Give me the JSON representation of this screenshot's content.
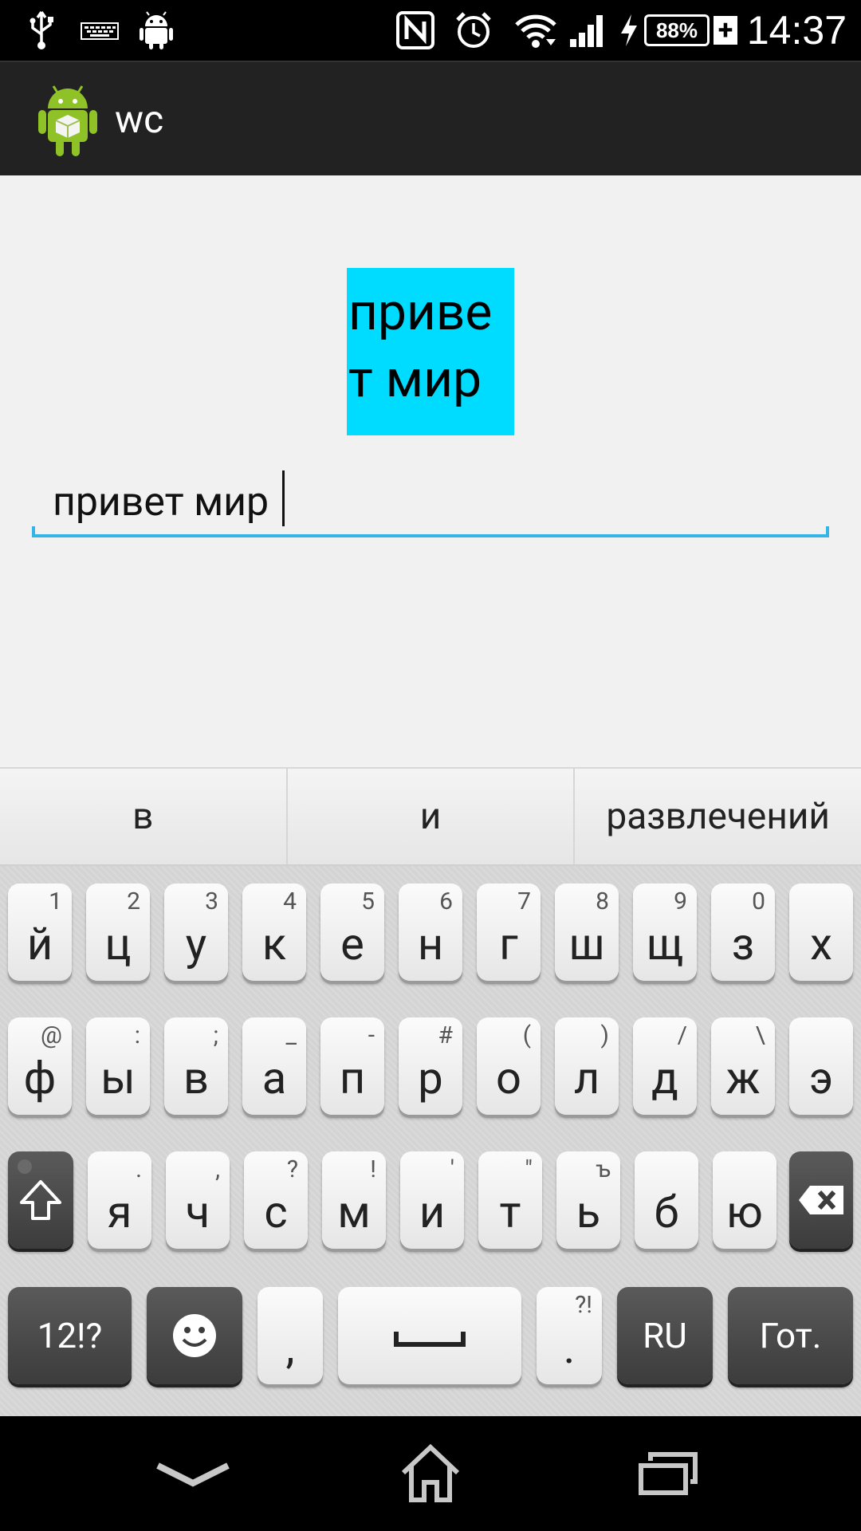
{
  "status_bar": {
    "time": "14:37",
    "battery_percent": "88%",
    "icons": [
      "usb-icon",
      "keyboard-icon",
      "android-debug-icon",
      "nfc-icon",
      "alarm-icon",
      "wifi-icon",
      "signal-icon",
      "charging-icon",
      "battery-icon"
    ]
  },
  "action_bar": {
    "title": "wc",
    "icon": "android-app-icon"
  },
  "content": {
    "label_text": "привет мир",
    "label_background": "#00dcff",
    "input_value": "привет мир ",
    "input_underline_color": "#33b5e5"
  },
  "suggestions": [
    "в",
    "и",
    "развлечений"
  ],
  "keyboard": {
    "row1": [
      {
        "char": "й",
        "hint": "1"
      },
      {
        "char": "ц",
        "hint": "2"
      },
      {
        "char": "у",
        "hint": "3"
      },
      {
        "char": "к",
        "hint": "4"
      },
      {
        "char": "е",
        "hint": "5"
      },
      {
        "char": "н",
        "hint": "6"
      },
      {
        "char": "г",
        "hint": "7"
      },
      {
        "char": "ш",
        "hint": "8"
      },
      {
        "char": "щ",
        "hint": "9"
      },
      {
        "char": "з",
        "hint": "0"
      },
      {
        "char": "х",
        "hint": ""
      }
    ],
    "row2": [
      {
        "char": "ф",
        "hint": "@"
      },
      {
        "char": "ы",
        "hint": ":"
      },
      {
        "char": "в",
        "hint": ";"
      },
      {
        "char": "а",
        "hint": "_"
      },
      {
        "char": "п",
        "hint": "-"
      },
      {
        "char": "р",
        "hint": "#"
      },
      {
        "char": "о",
        "hint": "("
      },
      {
        "char": "л",
        "hint": ")"
      },
      {
        "char": "д",
        "hint": "/"
      },
      {
        "char": "ж",
        "hint": "\\"
      },
      {
        "char": "э",
        "hint": ""
      }
    ],
    "row3": [
      {
        "char": "я",
        "hint": "."
      },
      {
        "char": "ч",
        "hint": ","
      },
      {
        "char": "с",
        "hint": "?"
      },
      {
        "char": "м",
        "hint": "!"
      },
      {
        "char": "и",
        "hint": "'"
      },
      {
        "char": "т",
        "hint": "\""
      },
      {
        "char": "ь",
        "hint": "ъ"
      },
      {
        "char": "б",
        "hint": ""
      },
      {
        "char": "ю",
        "hint": ""
      }
    ],
    "symbols_label": "12!?",
    "comma_label": ",",
    "period_label": ".",
    "period_hint": "?!",
    "language_label": "RU",
    "done_label": "Гот.",
    "shift_icon": "shift-icon",
    "backspace_icon": "backspace-icon",
    "emoji_icon": "smiley-icon",
    "space_icon": "space-icon"
  },
  "nav_bar": {
    "icons": [
      "back-chevron-icon",
      "home-icon",
      "recents-icon"
    ]
  }
}
